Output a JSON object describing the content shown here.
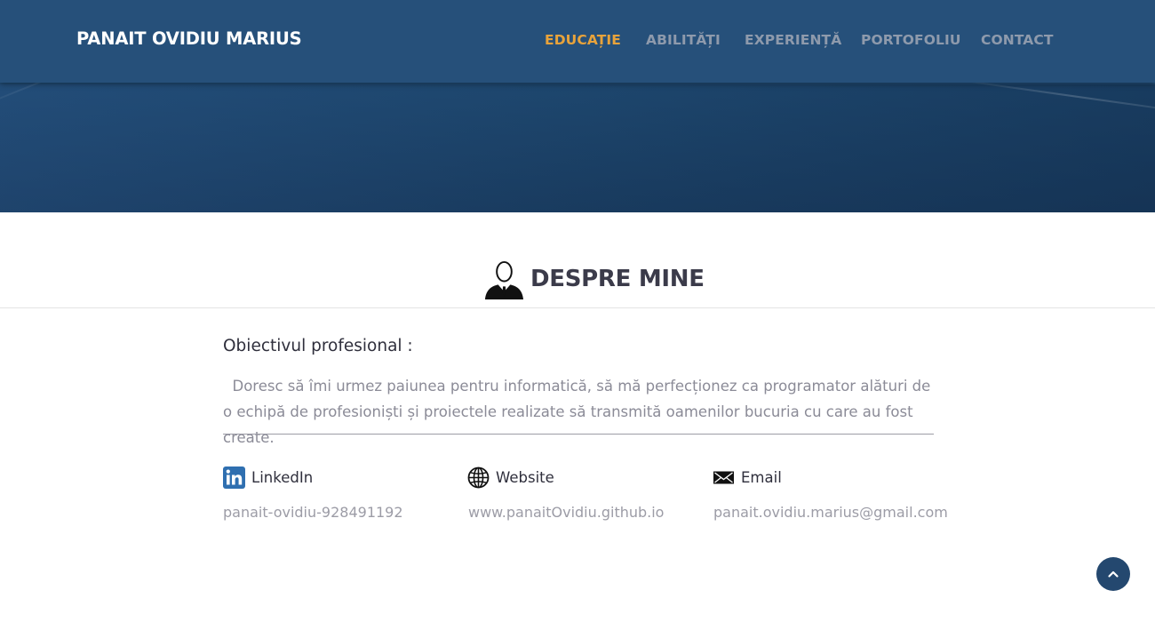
{
  "header": {
    "brand": "PANAIT OVIDIU MARIUS",
    "nav": [
      {
        "label": "EDUCAȚIE",
        "active": true
      },
      {
        "label": "ABILITĂȚI",
        "active": false
      },
      {
        "label": "EXPERIENȚĂ",
        "active": false
      },
      {
        "label": "PORTOFOLIU",
        "active": false
      },
      {
        "label": "CONTACT",
        "active": false
      }
    ]
  },
  "about": {
    "title": "DESPRE MINE",
    "title_icon": "person-suit-icon",
    "objective_heading": "Obiectivul profesional :",
    "objective_text": "Doresc să îmi urmez paiunea pentru informatică, să mă perfecționez ca programator alături de o echipă de profesioniști și proiectele realizate să transmită oamenilor bucuria cu care au fost create."
  },
  "contacts": [
    {
      "icon": "linkedin-icon",
      "label": "LinkedIn",
      "value": "panait-ovidiu-928491192"
    },
    {
      "icon": "globe-icon",
      "label": "Website",
      "value": "www.panaitOvidiu.github.io"
    },
    {
      "icon": "envelope-icon",
      "label": "Email",
      "value": "panait.ovidiu.marius@gmail.com"
    }
  ],
  "back_to_top": {
    "icon": "chevron-up-icon"
  },
  "colors": {
    "navbar": "#26507a",
    "accent_active": "#e8a33b",
    "nav_inactive": "#8e9aac",
    "back_to_top": "#24486f"
  }
}
